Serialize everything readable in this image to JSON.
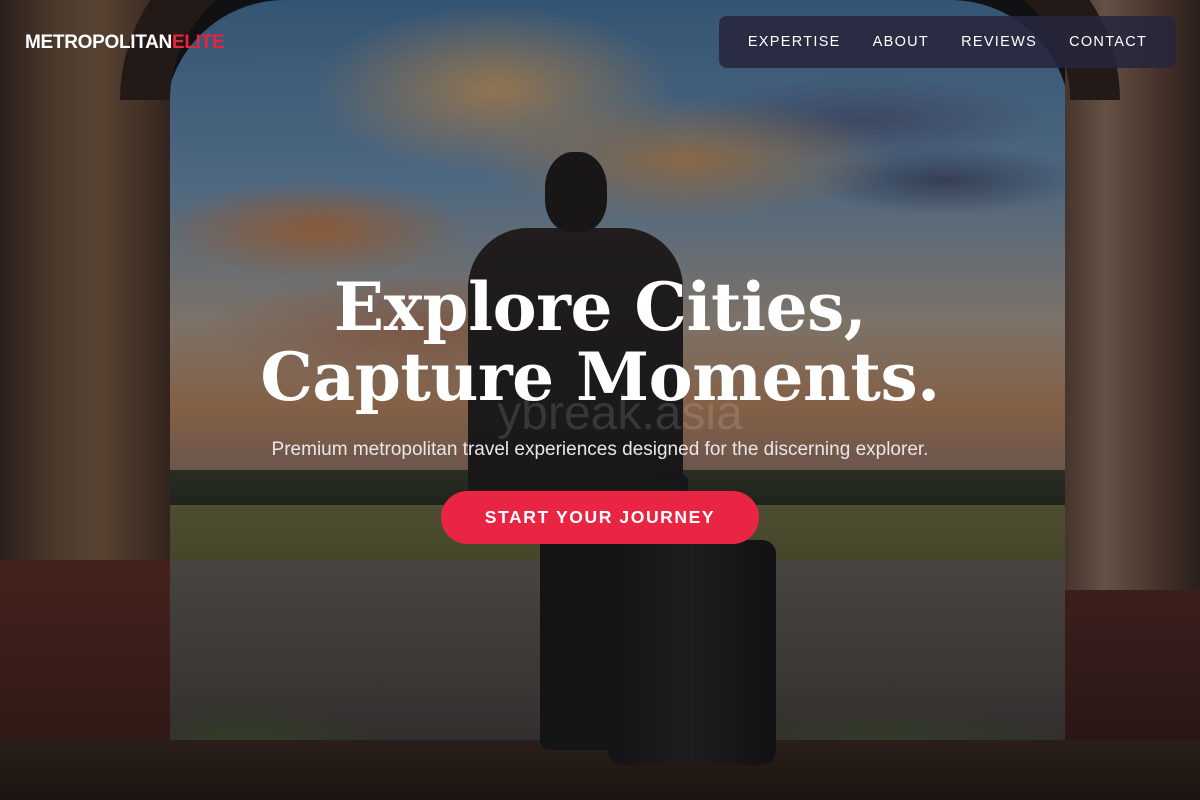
{
  "brand": {
    "name": "METROPOLITAN",
    "accent": "ELITE",
    "accent_color": "#e8223f"
  },
  "nav": {
    "items": [
      "EXPERTISE",
      "ABOUT",
      "REVIEWS",
      "CONTACT"
    ]
  },
  "hero": {
    "headline_line1": "Explore Cities,",
    "headline_line2": "Capture Moments.",
    "subheadline": "Premium metropolitan travel experiences designed for the discerning explorer.",
    "cta_label": "START YOUR JOURNEY",
    "cta_color": "#ea2443",
    "watermark": "ybreak.asia"
  }
}
